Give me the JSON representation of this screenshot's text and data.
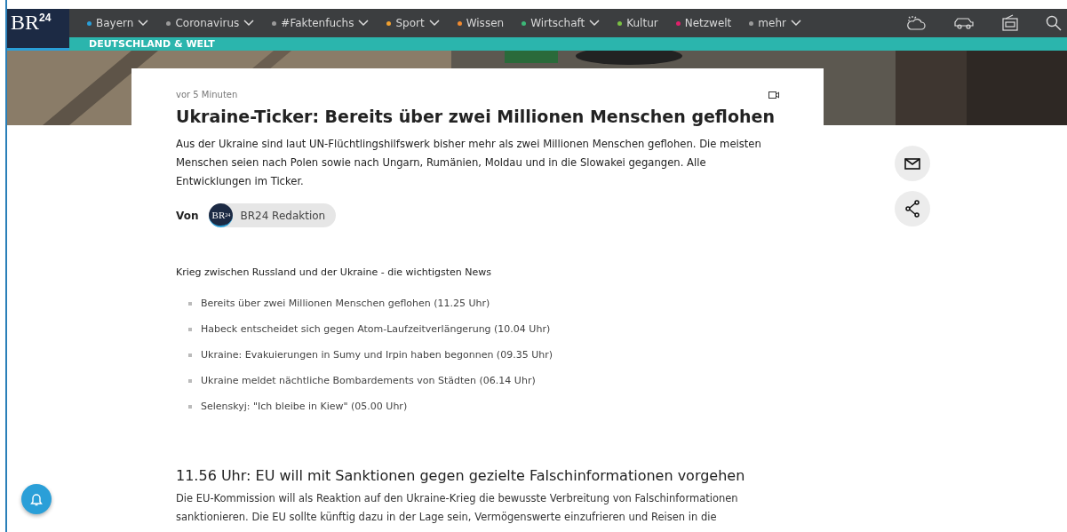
{
  "logo": {
    "text": "BR",
    "sup": "24"
  },
  "nav": [
    {
      "label": "Bayern",
      "color": "#2a9fd8",
      "dropdown": true
    },
    {
      "label": "Coronavirus",
      "color": "#9a9a9a",
      "dropdown": true
    },
    {
      "label": "#Faktenfuchs",
      "color": "#9a9a9a",
      "dropdown": true
    },
    {
      "label": "Sport",
      "color": "#f0a030",
      "dropdown": true
    },
    {
      "label": "Wissen",
      "color": "#f08a30",
      "dropdown": false
    },
    {
      "label": "Wirtschaft",
      "color": "#3cb878",
      "dropdown": true
    },
    {
      "label": "Kultur",
      "color": "#7ac043",
      "dropdown": false
    },
    {
      "label": "Netzwelt",
      "color": "#e0206a",
      "dropdown": false
    },
    {
      "label": "mehr",
      "color": "#9a9a9a",
      "dropdown": true
    }
  ],
  "subnav": "DEUTSCHLAND & WELT",
  "article": {
    "time": "vor 5 Minuten",
    "title": "Ukraine-Ticker: Bereits über zwei Millionen Menschen geflohen",
    "teaser": "Aus der Ukraine sind laut UN-Flüchtlingshilfswerk bisher mehr als zwei Millionen Menschen geflohen. Die meisten Menschen seien nach Polen sowie nach Ungarn, Rumänien, Moldau und in die Slowakei gegangen. Alle Entwicklungen im Ticker.",
    "by": "Von",
    "author": "BR24 Redaktion",
    "author_logo": "BR",
    "author_logo_sup": "24"
  },
  "summary": {
    "heading": "Krieg zwischen Russland und der Ukraine - die wichtigsten News",
    "items": [
      "Bereits über zwei Millionen Menschen geflohen (11.25 Uhr)",
      "Habeck entscheidet sich gegen Atom-Laufzeitverlängerung (10.04 Uhr)",
      "Ukraine: Evakuierungen in Sumy und Irpin haben begonnen (09.35 Uhr)",
      "Ukraine meldet nächtliche Bombardements von Städten (06.14 Uhr)",
      "Selenskyj: \"Ich bleibe in Kiew\" (05.00 Uhr)"
    ]
  },
  "entry": {
    "title": "11.56 Uhr: EU will mit Sanktionen gegen gezielte Falschinformationen vorgehen",
    "text": "Die EU-Kommission will als Reaktion auf den Ukraine-Krieg die bewusste Verbreitung von Falschinformationen sanktionieren. Die EU sollte künftig dazu in der Lage sein, Vermögenswerte einzufrieren und Reisen in die"
  }
}
